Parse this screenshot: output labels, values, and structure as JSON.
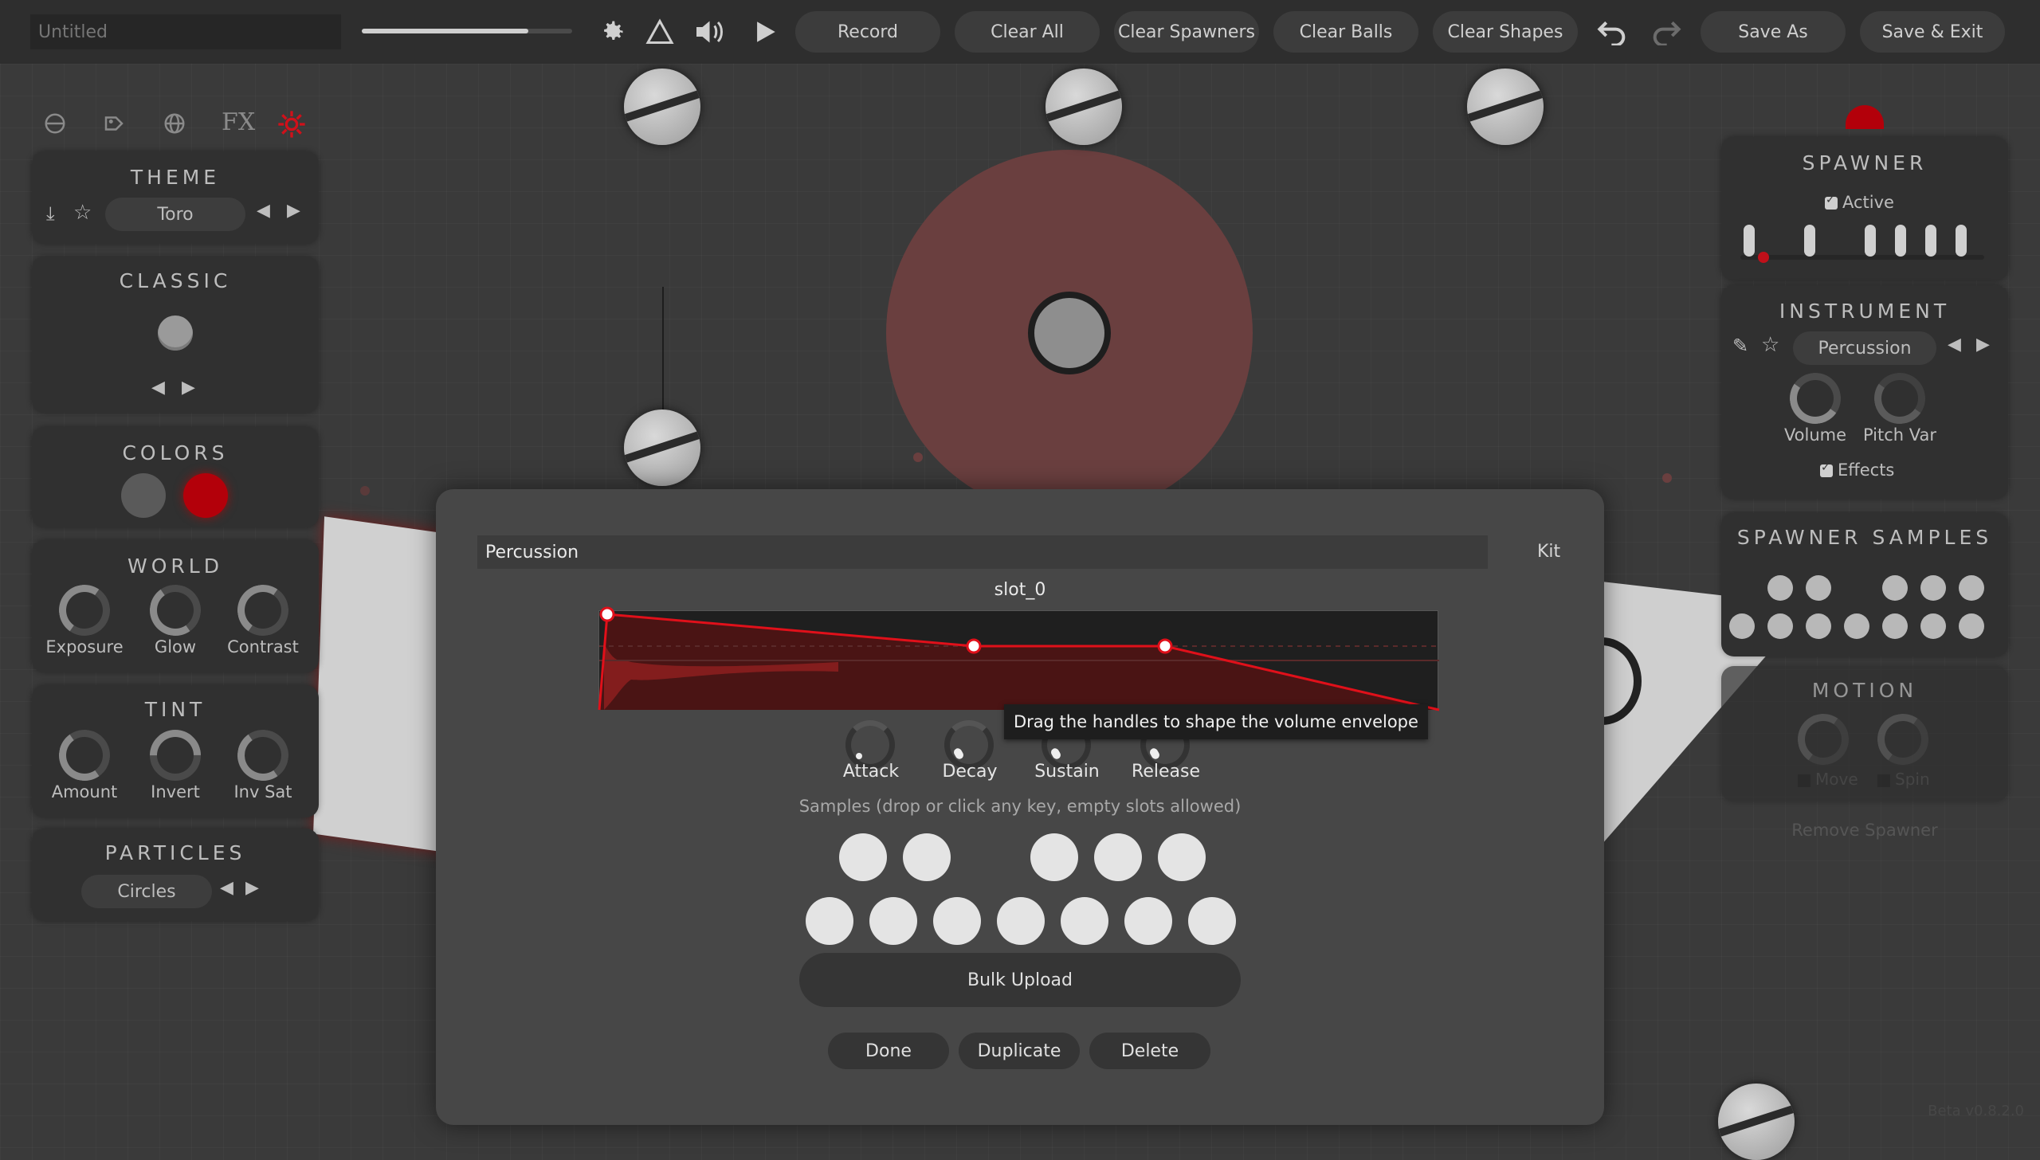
{
  "window": {
    "title_placeholder": "Untitled"
  },
  "toolbar": {
    "record": "Record",
    "clear_all": "Clear All",
    "clear_spawners": "Clear Spawners",
    "clear_balls": "Clear Balls",
    "clear_shapes": "Clear Shapes",
    "save_as": "Save As",
    "save_exit": "Save & Exit",
    "volume_level": 0.79
  },
  "left_tabs": [
    "globe-off-icon",
    "palette-icon",
    "world-icon",
    "FX",
    "sun-icon"
  ],
  "theme": {
    "title": "THEME",
    "value": "Toro"
  },
  "classic": {
    "title": "CLASSIC"
  },
  "colors": {
    "title": "COLORS",
    "swatches": [
      "#5a5a5a",
      "#b3000a"
    ]
  },
  "world": {
    "title": "WORLD",
    "knobs": [
      "Exposure",
      "Glow",
      "Contrast"
    ]
  },
  "tint": {
    "title": "TINT",
    "knobs": [
      "Amount",
      "Invert",
      "Inv Sat"
    ]
  },
  "particles": {
    "title": "PARTICLES",
    "value": "Circles"
  },
  "spawner": {
    "title": "SPAWNER",
    "active_label": "Active"
  },
  "instrument": {
    "title": "INSTRUMENT",
    "value": "Percussion",
    "knobs": [
      "Volume",
      "Pitch Var"
    ],
    "effects_label": "Effects"
  },
  "spawner_samples": {
    "title": "SPAWNER SAMPLES"
  },
  "motion": {
    "title": "MOTION",
    "move_label": "Move",
    "spin_label": "Spin",
    "remove_label": "Remove Spawner"
  },
  "version": "Beta v0.8.2.0",
  "modal": {
    "name_value": "Percussion",
    "kit_label": "Kit",
    "slot_label": "slot_0",
    "tooltip": "Drag the handles to shape the volume envelope",
    "envelope": [
      "Attack",
      "Decay",
      "Sustain",
      "Release"
    ],
    "samples_hint": "Samples (drop or click any key, empty slots allowed)",
    "bulk_upload": "Bulk Upload",
    "done": "Done",
    "duplicate": "Duplicate",
    "delete": "Delete"
  }
}
